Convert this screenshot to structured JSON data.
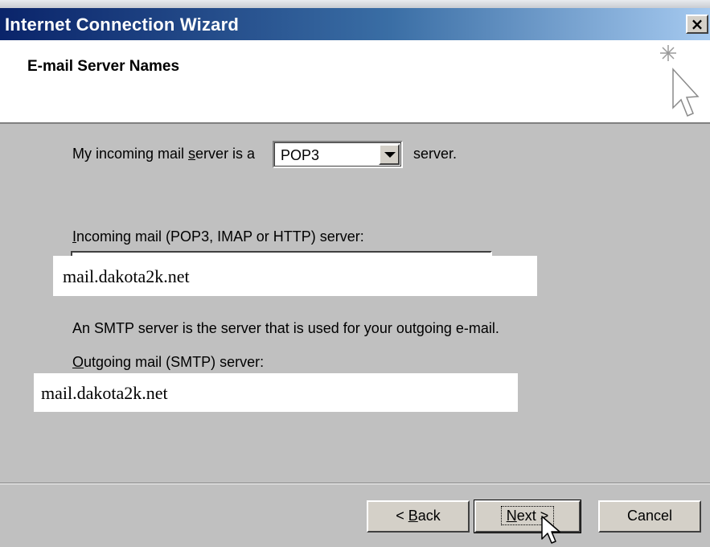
{
  "window": {
    "title": "Internet Connection Wizard",
    "close_label": "×"
  },
  "header": {
    "heading": "E-mail Server Names"
  },
  "incoming_type": {
    "prefix_before": "My incoming mail ",
    "prefix_underlined": "s",
    "prefix_after": "erver is a",
    "selected": "POP3",
    "suffix": "server."
  },
  "incoming_server": {
    "label_underlined": "I",
    "label_rest": "ncoming mail (POP3, IMAP or HTTP) server:",
    "value": "mail.dakota2k.net"
  },
  "smtp_info": "An SMTP server is the server that is used for your outgoing e-mail.",
  "outgoing_server": {
    "label_underlined": "O",
    "label_rest": "utgoing mail (SMTP) server:",
    "value": "mail.dakota2k.net"
  },
  "buttons": {
    "back_prefix": "< ",
    "back_underlined": "B",
    "back_rest": "ack",
    "next_underlined": "N",
    "next_rest": "ext >",
    "cancel": "Cancel"
  },
  "icons": {
    "wizard": "sparkle-cursor-icon",
    "close": "close-icon",
    "dropdown": "chevron-down-icon",
    "pointer": "mouse-pointer-icon"
  }
}
